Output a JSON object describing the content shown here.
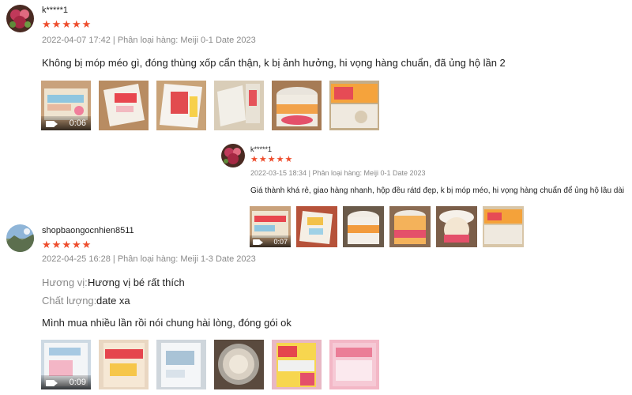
{
  "reviews": [
    {
      "username": "k*****1",
      "stars": 5,
      "date": "2022-04-07 17:42",
      "variation_label": "Phân loại hàng:",
      "variation": "Meiji 0-1 Date 2023",
      "comment": "Không bị móp méo gì, đóng thùng xốp cẩn thận, k bị ảnh hưởng, hi vọng hàng chuẩn, đã ủng hộ lần 2",
      "video_duration": "0:06"
    },
    {
      "username": "k*****1",
      "stars": 5,
      "date": "2022-03-15 18:34",
      "variation_label": "Phân loại hàng:",
      "variation": "Meiji 0-1 Date 2023",
      "comment": "Giá thành khá rẻ, giao hàng nhanh, hộp đều rátd đẹp, k bị móp méo, hi vọng hàng chuẩn để ủng hộ lâu dài",
      "video_duration": "0:07"
    },
    {
      "username": "shopbaongocnhien8511",
      "stars": 5,
      "date": "2022-04-25 16:28",
      "variation_label": "Phân loại hàng:",
      "variation": "Meiji 1-3 Date 2023",
      "attr_flavor_label": "Hương vị:",
      "attr_flavor": "Hương vị bé rất thích",
      "attr_quality_label": "Chất lượng:",
      "attr_quality": "date xa",
      "comment": "Mình mua nhiều lần rồi nói chung hài lòng, đóng gói ok",
      "video_duration": "0:09"
    }
  ],
  "separator": "|",
  "icons": {
    "star": "star-icon",
    "video": "video-camera-icon"
  },
  "colors": {
    "star": "#ee4d2d",
    "meta": "#8a8a8a",
    "text": "#222222"
  }
}
